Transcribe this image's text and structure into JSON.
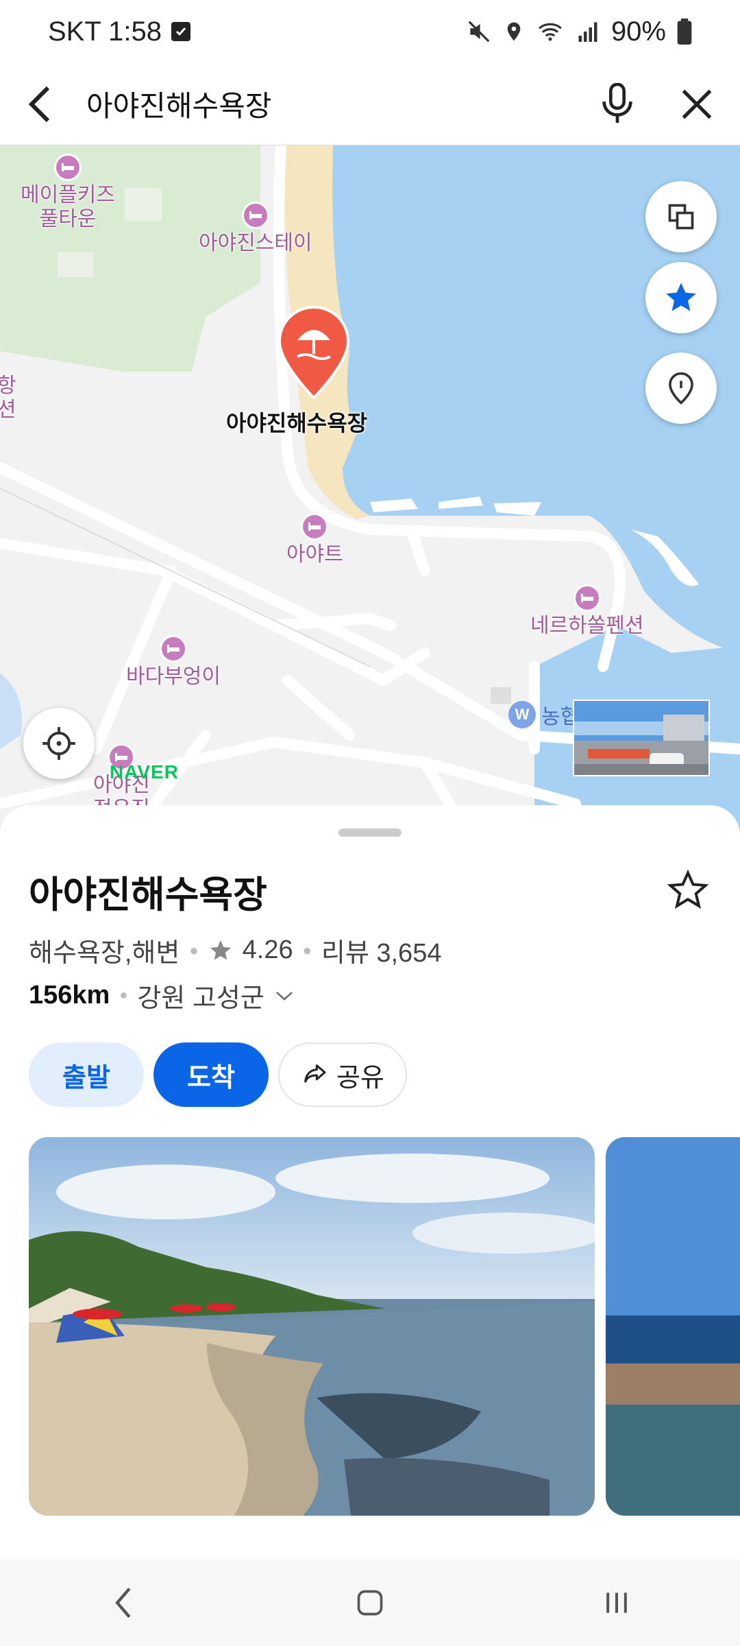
{
  "status_bar": {
    "carrier_time": "SKT 1:58",
    "battery": "90%"
  },
  "search": {
    "query": "아야진해수욕장"
  },
  "map": {
    "pois": [
      {
        "label": "메이플키즈\n풀타운"
      },
      {
        "label": "아야진스테이"
      },
      {
        "label": "아야트"
      },
      {
        "label": "네르하쏠펜션"
      },
      {
        "label": "바다부엉이"
      },
      {
        "label": "아야진\n정우진"
      }
    ],
    "edge_label": "항\n션",
    "main_pin_label": "아야진해수욕장",
    "bank_label": "농협",
    "bank_icon": "W",
    "naver_logo": "NAVER"
  },
  "place": {
    "title": "아야진해수욕장",
    "category": "해수욕장,해변",
    "rating": "4.26",
    "reviews": "리뷰 3,654",
    "distance": "156km",
    "region": "강원 고성군"
  },
  "actions": {
    "depart": "출발",
    "arrive": "도착",
    "share": "공유"
  },
  "colors": {
    "accent": "#0a66e6",
    "pin": "#f05a45",
    "sea": "#a6d1f2",
    "sand": "#f5e6bf",
    "park": "#d9ebd3"
  }
}
